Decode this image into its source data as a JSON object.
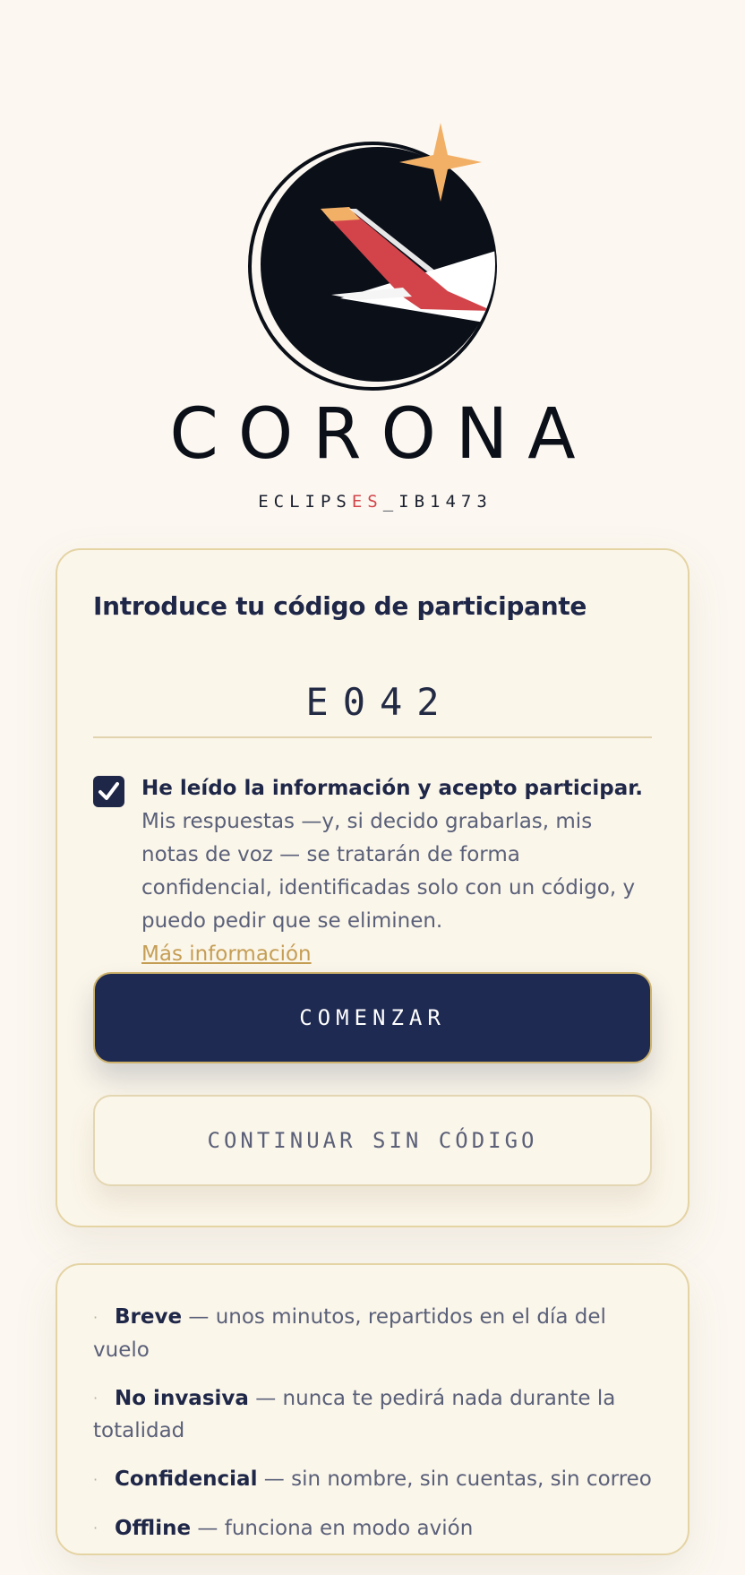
{
  "brand": {
    "name": "CORONA",
    "subtitle_prefix": "ECLIPS",
    "subtitle_accent": "ES",
    "subtitle_suffix": "_IB1473"
  },
  "form": {
    "prompt": "Introduce tu código de participante",
    "code_value": "E042",
    "consent_checked": true,
    "consent_bold": "He leído la información y acepto participar.",
    "consent_text": " Mis respuestas —y, si decido grabarlas, mis notas de voz — se tratarán de forma confidencial, identificadas solo con un código, y puedo pedir que se eliminen.",
    "more_info_link": "Más información",
    "start_button": "COMENZAR",
    "continue_button": "CONTINUAR SIN CÓDIGO"
  },
  "features": [
    {
      "title": "Breve",
      "text": " — unos minutos, repartidos en el día del vuelo"
    },
    {
      "title": "No invasiva",
      "text": " — nunca te pedirá nada durante la totalidad"
    },
    {
      "title": "Confidencial",
      "text": " — sin nombre, sin cuentas, sin correo"
    },
    {
      "title": "Offline",
      "text": " — funciona en modo avión"
    }
  ],
  "colors": {
    "background": "#fcf8f1",
    "navy": "#1f2a52",
    "accent_red": "#d2444a",
    "gold": "#c59e55",
    "star": "#f2b067"
  },
  "icons": [
    "eclipse-plane-logo-icon",
    "star-icon",
    "check-icon"
  ]
}
